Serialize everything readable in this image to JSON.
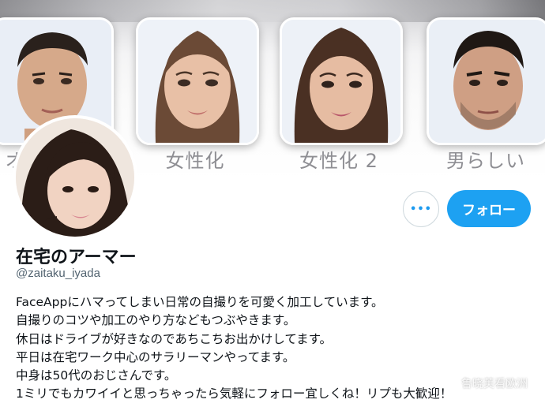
{
  "banner": {
    "tiles": [
      {
        "label": "オ"
      },
      {
        "label": "女性化"
      },
      {
        "label": "女性化 2"
      },
      {
        "label": "男らしい"
      }
    ]
  },
  "actions": {
    "more_label": "•••",
    "follow_label": "フォロー"
  },
  "profile": {
    "display_name": "在宅のアーマー",
    "handle": "@zaitaku_iyada",
    "bio": [
      "FaceAppにハマってしまい日常の自撮りを可愛く加工しています。",
      "自撮りのコツや加工のやり方などもつぶやきます。",
      "休日はドライブが好きなのであちこちお出かけしてます。",
      "平日は在宅ワーク中心のサラリーマンやってます。",
      "中身は50代のおじさんです。",
      "1ミリでもカワイイと思っちゃったら気軽にフォロー宜しくね！リプも大歓迎！"
    ]
  },
  "watermark": {
    "text": "鲁晓芙看欧洲"
  },
  "colors": {
    "accent": "#1da1f2",
    "secondary_text": "#536471",
    "label_gray": "#8e8e93"
  }
}
